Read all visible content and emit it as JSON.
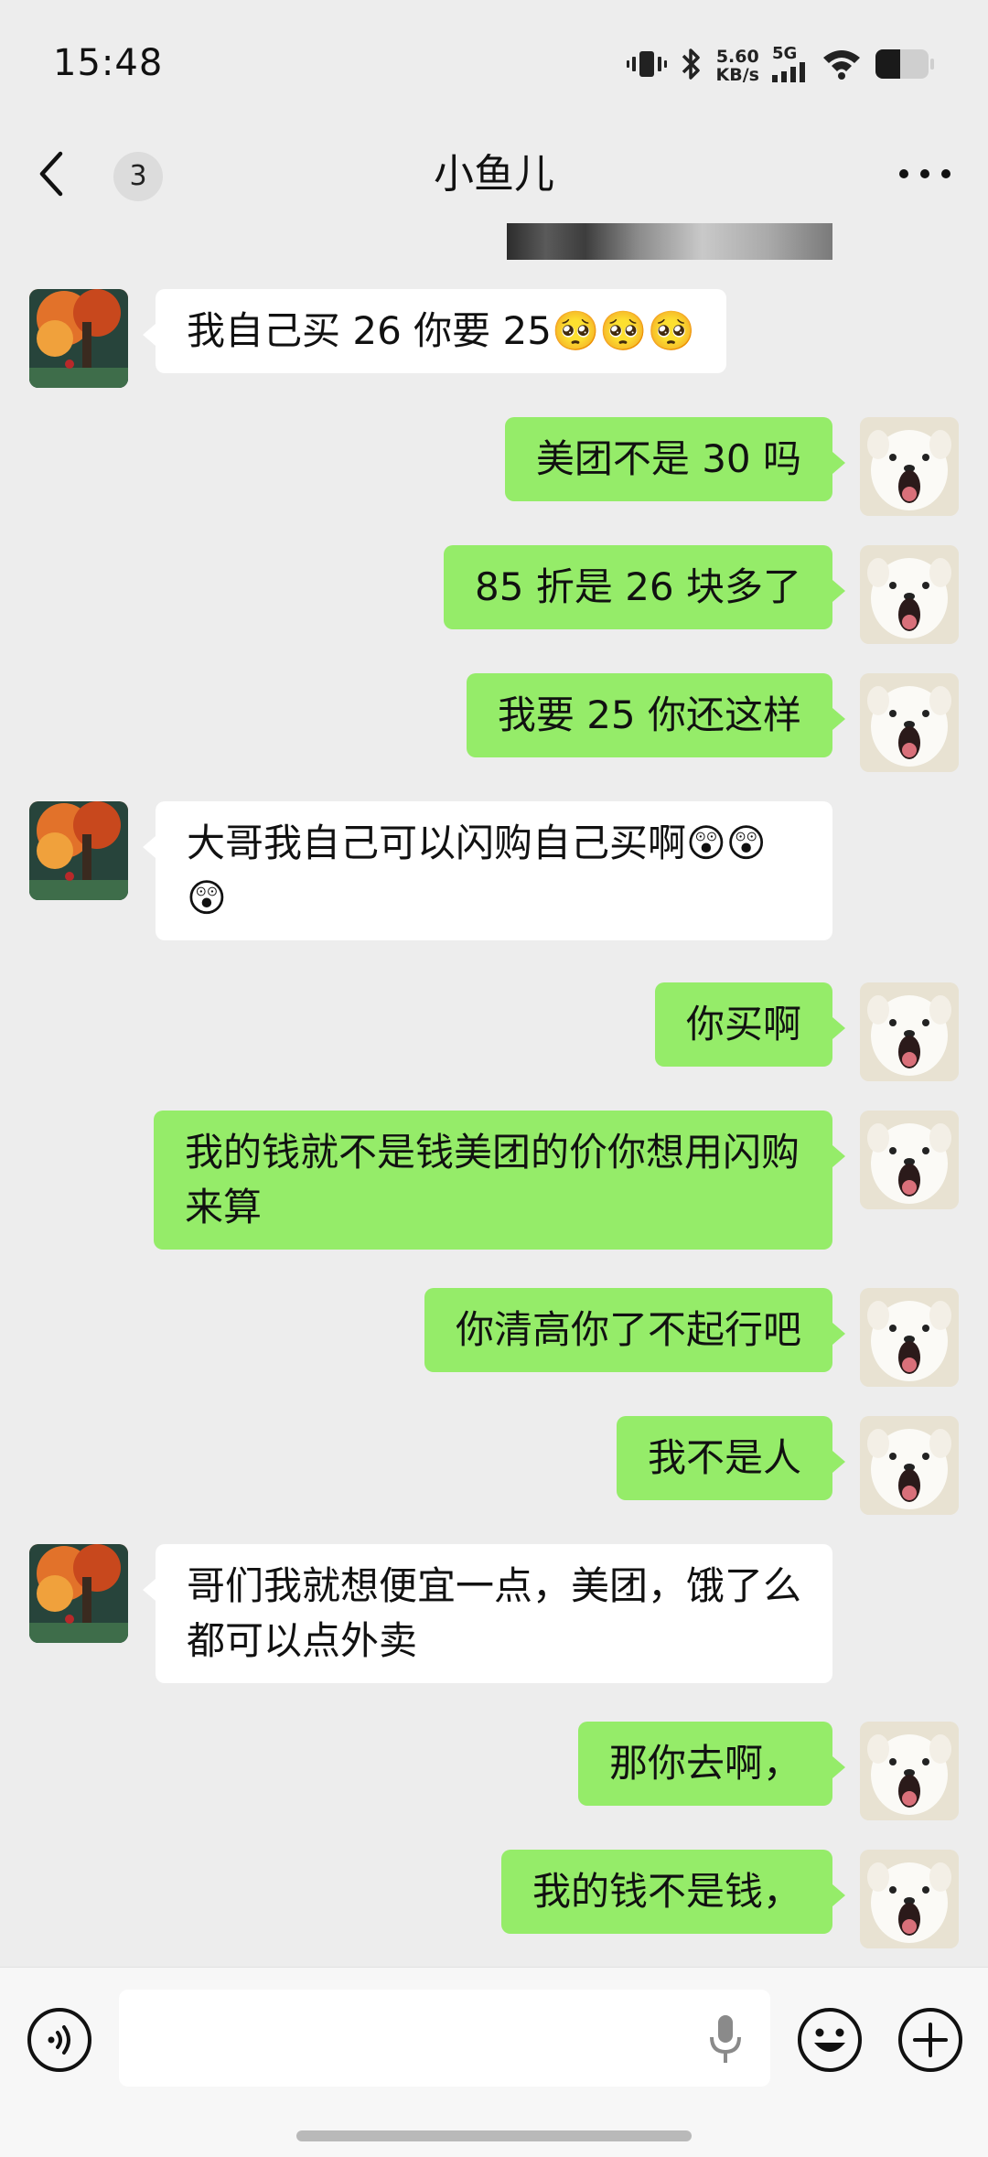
{
  "status_bar": {
    "time": "15:48",
    "net_speed_value": "5.60",
    "net_speed_unit": "KB/s",
    "network_type": "5G",
    "icons": [
      "vibrate-icon",
      "bluetooth-icon",
      "signal-icon",
      "wifi-icon",
      "battery-icon"
    ]
  },
  "header": {
    "unread_count": "3",
    "title": "小鱼儿",
    "icons": [
      "back-chevron-icon",
      "more-icon"
    ]
  },
  "messages": [
    {
      "side": "in",
      "text": "我自己买 26 你要 25🥺🥺🥺"
    },
    {
      "side": "out",
      "text": "美团不是 30 吗"
    },
    {
      "side": "out",
      "text": "85 折是 26 块多了"
    },
    {
      "side": "out",
      "text": "我要 25 你还这样"
    },
    {
      "side": "in",
      "text": "大哥我自己可以闪购自己买啊😲😲😲"
    },
    {
      "side": "out",
      "text": "你买啊"
    },
    {
      "side": "out",
      "text": "我的钱就不是钱美团的价你想用闪购来算"
    },
    {
      "side": "out",
      "text": "你清高你了不起行吧"
    },
    {
      "side": "out",
      "text": "我不是人"
    },
    {
      "side": "in",
      "text": "哥们我就想便宜一点，美团，饿了么都可以点外卖"
    },
    {
      "side": "out",
      "text": "那你去啊，"
    },
    {
      "side": "out",
      "text": "我的钱不是钱，"
    }
  ],
  "input_bar": {
    "value": "",
    "icons": [
      "voice-icon",
      "mic-icon",
      "emoji-icon",
      "plus-icon"
    ]
  },
  "colors": {
    "background": "#ededed",
    "outgoing_bubble": "#95ec69",
    "incoming_bubble": "#ffffff"
  }
}
